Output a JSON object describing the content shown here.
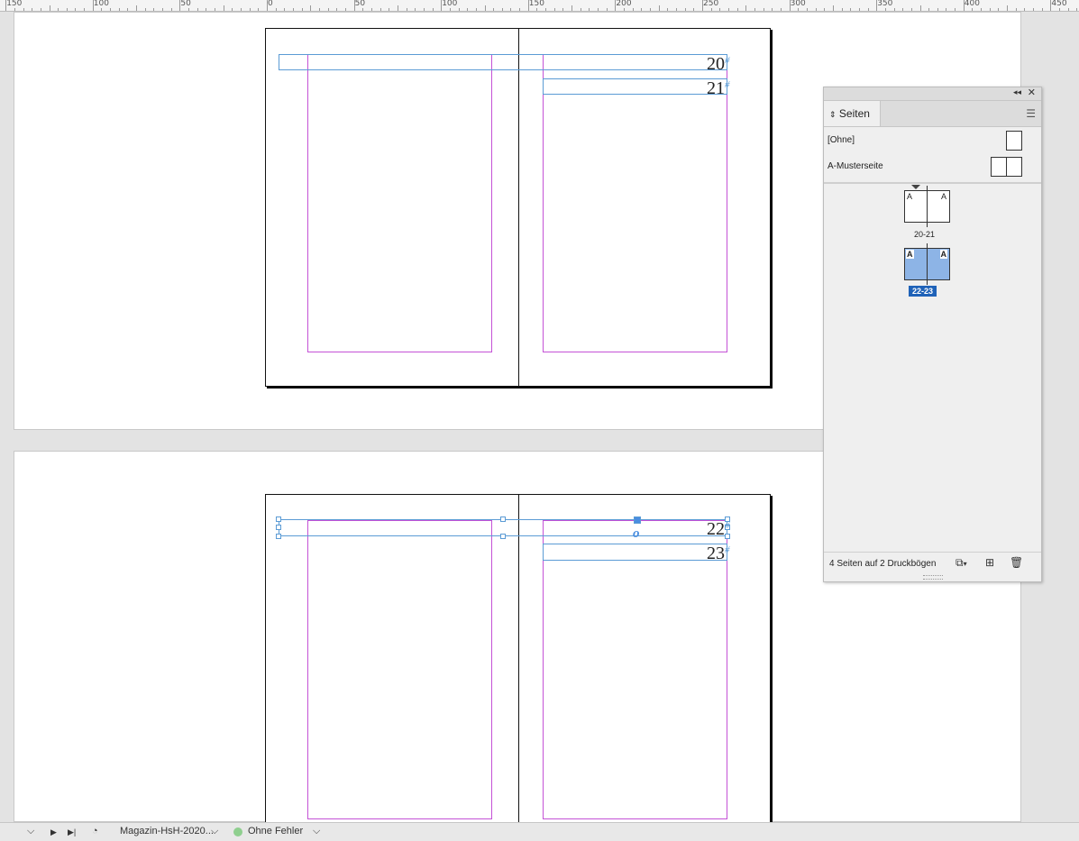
{
  "ruler": {
    "labels": [
      "150",
      "100",
      "50",
      "0",
      "50",
      "100",
      "150",
      "200",
      "250",
      "300",
      "350",
      "400",
      "450"
    ]
  },
  "spread_top": {
    "page_numbers": [
      "20",
      "21"
    ],
    "hash": "#"
  },
  "spread_bottom": {
    "page_numbers": [
      "22",
      "23"
    ],
    "hash": "#",
    "overset_glyph": "o"
  },
  "pages_panel": {
    "tab_title": "Seiten",
    "tab_icon": "up-down-arrow-icon",
    "menu_icon": "panel-menu-icon",
    "masters": [
      {
        "label": "[Ohne]"
      },
      {
        "label": "A-Musterseite"
      }
    ],
    "spreads": [
      {
        "label": "20-21",
        "left_master": "A",
        "right_master": "A",
        "selected": false
      },
      {
        "label": "22-23",
        "left_master": "A",
        "right_master": "A",
        "selected": true
      }
    ],
    "status": "4 Seiten auf 2 Druckbögen",
    "footer_icons": [
      "edit-page-size-icon",
      "new-page-icon",
      "delete-page-icon"
    ]
  },
  "statusbar": {
    "document_name": "Magazin-HsH-2020...",
    "preflight_status": "Ohne Fehler",
    "preflight_color": "#8fcf8f"
  },
  "colors": {
    "margin_guide": "#c452d6",
    "frame_edge": "#5b9bd5",
    "selection": "#1f62b8"
  }
}
